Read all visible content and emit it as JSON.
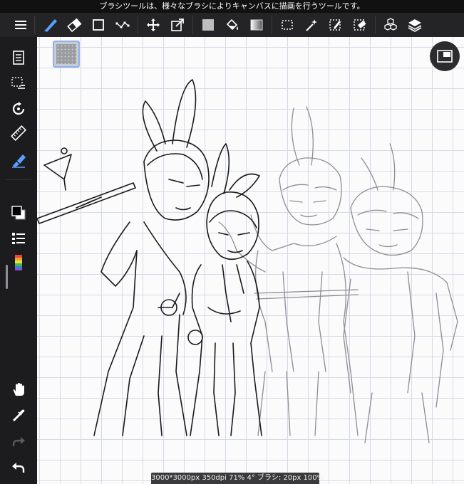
{
  "tooltip": "ブラシツールは、様々なブラシによりキャンバスに描画を行うツールです。",
  "status": "3000*3000px 350dpi 71% 4° ブラシ: 20px 100%",
  "colors": {
    "accent": "#5aa0ff",
    "toolbar_bg": "#242426",
    "canvas_bg": "#fbfbfc",
    "grid": "#d6dae6",
    "primary_color": "#000000",
    "secondary_color": "#ffffff"
  },
  "toolbar": {
    "icons": [
      "menu-icon",
      "brush-icon",
      "eraser-icon",
      "shape-icon",
      "bezier-icon",
      "move-icon",
      "transform-icon",
      "fill-color-icon",
      "bucket-icon",
      "gradient-icon",
      "select-rect-icon",
      "magic-wand-icon",
      "select-pen-icon",
      "select-eraser-icon",
      "materials-icon",
      "layers-icon"
    ],
    "active_tool": "brush-icon"
  },
  "sidebar": {
    "icons": [
      "document-icon",
      "select-menu-icon",
      "rotate-icon",
      "ruler-icon",
      "brush-size-icon",
      "color-swatch-icon",
      "brush-list-icon",
      "color-palette-icon",
      "hand-icon",
      "eyedropper-icon",
      "redo-icon",
      "undo-icon"
    ],
    "redo_enabled": false
  }
}
